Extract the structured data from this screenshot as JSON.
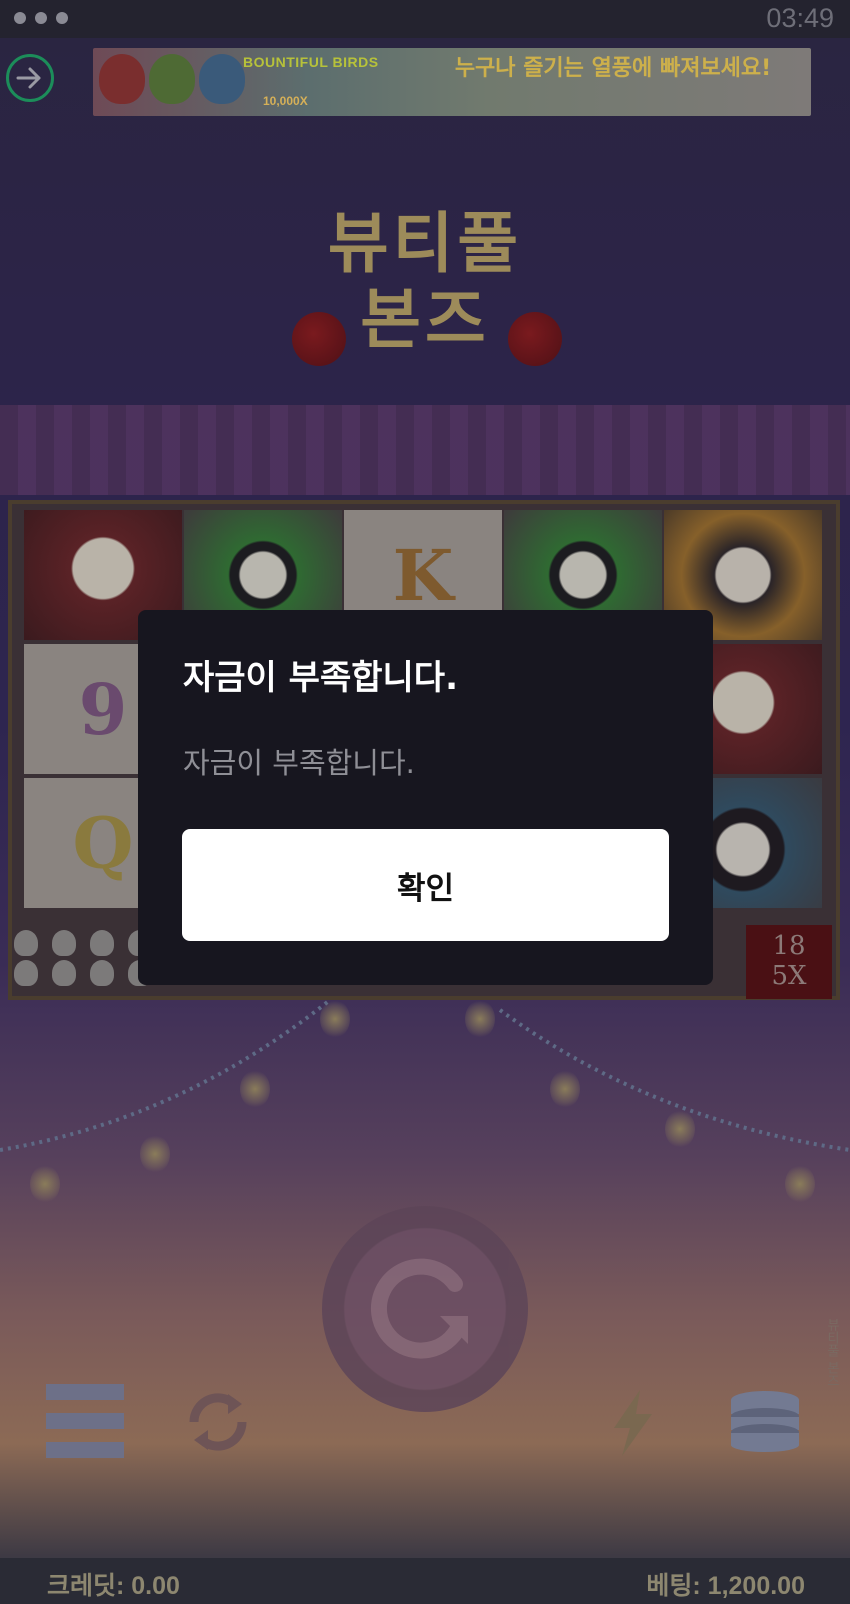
{
  "status_bar": {
    "time": "03:49"
  },
  "banner": {
    "logo_text": "BOUNTIFUL BIRDS",
    "logo_sub": "10,000X",
    "promo_text": "누구나 즐기는 열풍에 빠져보세요!"
  },
  "game": {
    "title_line1": "뷰티풀",
    "title_line2": "본즈",
    "side_label": "뷰티풀 본즈",
    "reel_symbols": [
      "K",
      "9",
      "Q"
    ],
    "multiplier_top": "18",
    "multiplier_bottom": "5X"
  },
  "footer": {
    "credit_text": "크레딧: 0.00",
    "bet_text": "베팅: 1,200.00"
  },
  "dialog": {
    "title": "자금이 부족합니다.",
    "message": "자금이 부족합니다.",
    "confirm_label": "확인"
  },
  "icons": {
    "back": "arrow-right-circle-icon",
    "menu": "hamburger-menu-icon",
    "autoplay": "autoplay-icon",
    "spin": "spin-icon",
    "turbo": "lightning-icon",
    "bet": "coin-stack-icon"
  },
  "colors": {
    "back_ring": "#1c8d5a",
    "dialog_bg": "#17161f",
    "button_bg": "#ffffff",
    "footer_text": "#8d8770"
  }
}
